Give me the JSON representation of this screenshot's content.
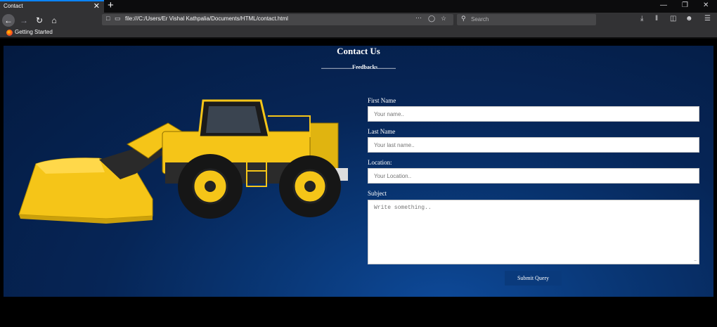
{
  "browser": {
    "tab_title": "Contact",
    "tab_close": "✕",
    "new_tab": "+",
    "url": "file:///C:/Users/Er Vishal Kathpalia/Documents/HTML/contact.html",
    "search_placeholder": "Search",
    "bookmark": "Getting Started",
    "accent_color": "#0a84ff",
    "icons": [
      "back-arrow-icon",
      "forward-arrow-icon",
      "reload-icon",
      "home-icon",
      "page-icon",
      "page-actions-icon",
      "pocket-icon",
      "star-icon",
      "search-icon",
      "download-icon",
      "library-icon",
      "sidebar-icon",
      "account-icon",
      "menu-icon",
      "minimize-icon",
      "restore-icon",
      "close-icon"
    ]
  },
  "page": {
    "title": "Contact Us",
    "subtitle": "......................Feedbacks.............",
    "form": {
      "first_name_label": "First Name",
      "first_name_placeholder": "Your name..",
      "last_name_label": "Last Name",
      "last_name_placeholder": "Your last name..",
      "location_label": "Location:",
      "location_placeholder": "Your Location..",
      "subject_label": "Subject",
      "subject_placeholder": "Write something..",
      "submit_label": "Submit Query"
    },
    "colors": {
      "background_dark": "#041a40",
      "background_light": "#0e4a9a",
      "button": "#0a3a7c",
      "loader_yellow": "#f5c518"
    }
  }
}
